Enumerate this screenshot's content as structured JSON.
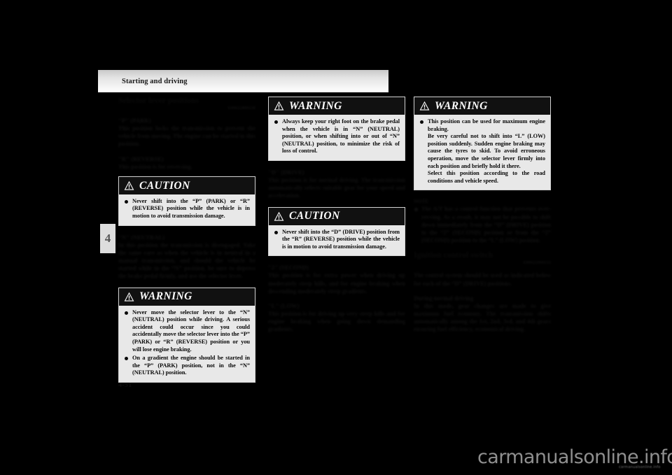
{
  "page": {
    "header_title": "Starting and driving",
    "chapter_tab": "4",
    "page_number": "4-51",
    "watermark": "carmanualsonline.info",
    "watermark_sub": "carmanualsonline.info"
  },
  "col1": {
    "section_title": "Selector lever positions",
    "ref_code": "E00622800130",
    "p_head": "\"P\" (PARK)",
    "p_body": "This position locks the transmission to prevent the vehicle from moving. The engine can be started in this position.",
    "r_head": "\"R\" (REVERSE)",
    "r_body": "This position is for reversing.",
    "caution": {
      "label": "CAUTION",
      "icon": "warning-triangle-icon",
      "items": [
        "Never shift into the “P” (PARK) or “R” (REVERSE) position while the vehicle is in motion to avoid transmission damage."
      ]
    },
    "n_head": "\"N\" (NEUTRAL)",
    "n_body": "In this position the transmission is disengaged. Take the same care as when the vehicle is in neutral in a manual transmission, and should the vehicle be started while in the “N” position, be sure to depress the brake pedal firmly, and use the selector lever.",
    "warning": {
      "label": "WARNING",
      "icon": "warning-triangle-icon",
      "items": [
        "Never move the selector lever to the “N” (NEUTRAL) position while driving. A serious accident could occur since you could accidentally move the selector lever into the “P” (PARK) or “R” (REVERSE) position or you will lose engine braking.",
        "On a gradient the engine should be started in the “P” (PARK) position, not in the “N” (NEUTRAL) position."
      ]
    }
  },
  "col2": {
    "warning": {
      "label": "WARNING",
      "icon": "warning-triangle-icon",
      "items": [
        "Always keep your right foot on the brake pedal when the vehicle is in “N” (NEUTRAL) position, or when shifting into or out of “N” (NEUTRAL) position, to minimize the risk of loss of control."
      ]
    },
    "d_head": "\"D\" (DRIVE)",
    "d_body": "This position is for normal driving. The transmission automatically selects suitable gear for your speed and acceleration.",
    "caution": {
      "label": "CAUTION",
      "icon": "warning-triangle-icon",
      "items": [
        "Never shift into the “D” (DRIVE) position from the “R” (REVERSE) position while the vehicle is in motion to avoid transmission damage."
      ]
    },
    "two_head": "\"2\" (SECOND)",
    "two_body": "This position is for extra power when driving up moderately steep hills, and for engine braking when descending moderately steep gradients.",
    "l_head": "\"L\" (LOW)",
    "l_body": "This position is for driving up very steep hills and for engine braking when going down demanding gradients."
  },
  "col3": {
    "warning": {
      "label": "WARNING",
      "icon": "warning-triangle-icon",
      "items": [
        "This position can be used for maximum engine braking.\nBe very careful not to shift into “L” (LOW) position suddenly. Sudden engine braking may cause the tyres to skid. To avoid erroneous operation, move the selector lever firmly into each position and briefly hold it there.\nSelect this position according to the road conditions and vehicle speed."
      ]
    },
    "note_head": "NOTE",
    "note_item": "The A/T has a control function that prevents over-revving. As a result, it may not be possible to shift down immediately from the “D” (DRIVE) position to the “2” (SECOND) position or from the “2” (SECOND) position to the “L” (LOW) position.",
    "ign_title": "Ignition control switch",
    "ign_ref": "E00622900153",
    "ign_body": "The control system should be used as indicated below for each of the “D” (DRIVE) positions.",
    "normal_head": "During normal driving",
    "normal_body": "In this mode, gear changes are made to give maximum fuel economy. The transmission shifts automatically among the 1st, 2nd, 3rd, and 4th gears ensuring fuel efficiency, economical driving."
  }
}
